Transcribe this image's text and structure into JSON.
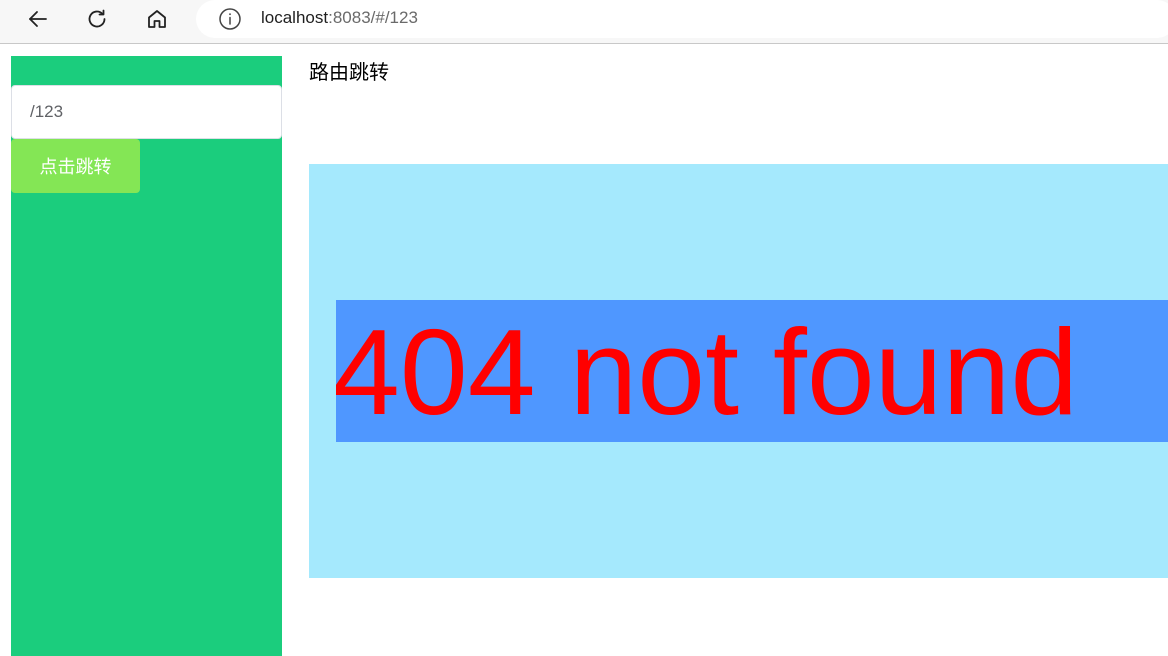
{
  "browser": {
    "url_host": "localhost",
    "url_rest": ":8083/#/123",
    "icons": {
      "back": "arrow-left-icon",
      "reload": "reload-icon",
      "home": "home-icon",
      "info": "info-icon"
    }
  },
  "sidebar": {
    "input_value": "/123",
    "button_label": "点击跳转",
    "background_color": "#1bcd7d",
    "button_color": "#84e655"
  },
  "main": {
    "title": "路由跳转",
    "not_found_text": "404 not found",
    "content_bg_color": "#a5e9fd",
    "banner_bg_color": "#4f97ff",
    "text_color": "#ff0000"
  }
}
